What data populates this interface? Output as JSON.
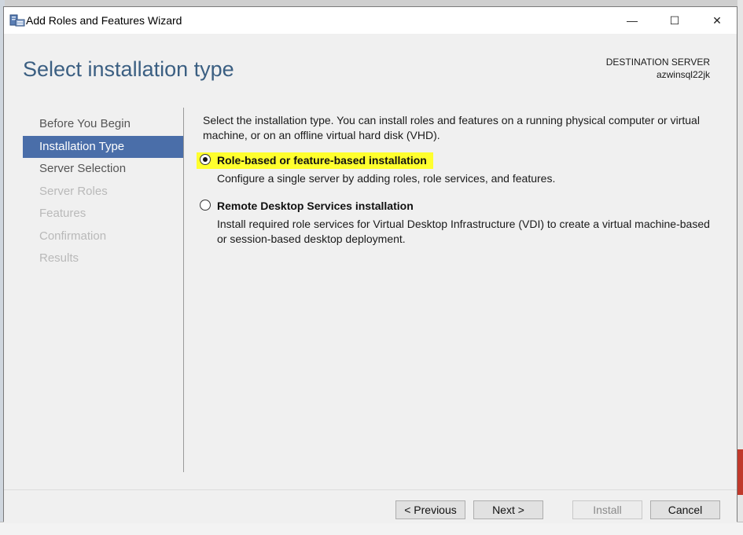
{
  "window": {
    "title": "Add Roles and Features Wizard",
    "controls": {
      "minimize": "—",
      "maximize": "☐",
      "close": "✕"
    }
  },
  "header": {
    "page_title": "Select installation type",
    "destination_label": "DESTINATION SERVER",
    "destination_server": "azwinsql22jk"
  },
  "nav": {
    "items": [
      {
        "label": "Before You Begin",
        "state": "enabled"
      },
      {
        "label": "Installation Type",
        "state": "active"
      },
      {
        "label": "Server Selection",
        "state": "enabled"
      },
      {
        "label": "Server Roles",
        "state": "disabled"
      },
      {
        "label": "Features",
        "state": "disabled"
      },
      {
        "label": "Confirmation",
        "state": "disabled"
      },
      {
        "label": "Results",
        "state": "disabled"
      }
    ]
  },
  "main": {
    "intro": "Select the installation type. You can install roles and features on a running physical computer or virtual machine, or on an offline virtual hard disk (VHD).",
    "options": [
      {
        "label": "Role-based or feature-based installation",
        "description": "Configure a single server by adding roles, role services, and features.",
        "selected": true,
        "highlighted": true
      },
      {
        "label": "Remote Desktop Services installation",
        "description": "Install required role services for Virtual Desktop Infrastructure (VDI) to create a virtual machine-based or session-based desktop deployment.",
        "selected": false,
        "highlighted": false
      }
    ]
  },
  "footer": {
    "previous": "< Previous",
    "next": "Next >",
    "install": "Install",
    "cancel": "Cancel"
  },
  "colors": {
    "accent_nav": "#4a6ea9",
    "title_blue": "#3b5f82",
    "highlight": "#ffff2e"
  }
}
